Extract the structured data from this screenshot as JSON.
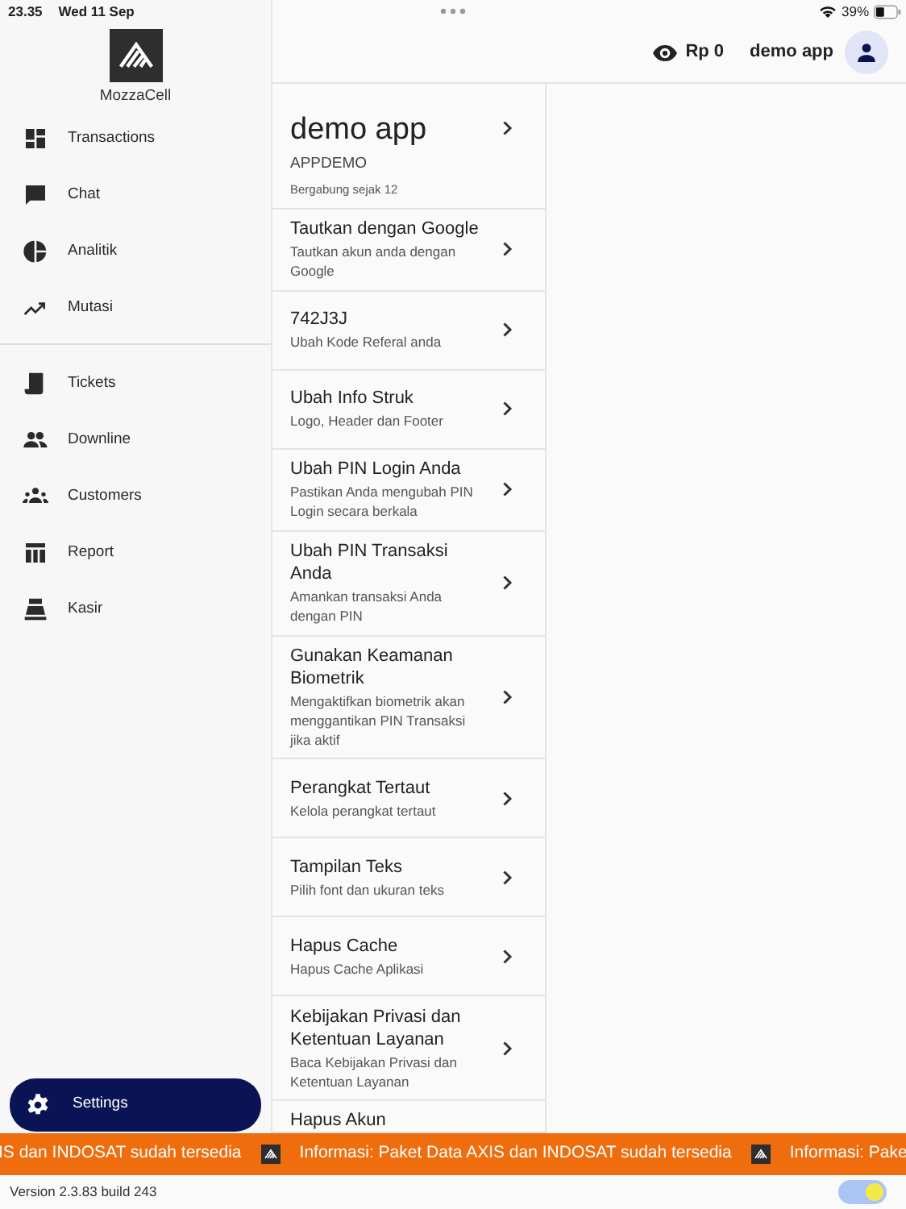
{
  "status_bar": {
    "time": "23.35",
    "date": "Wed 11 Sep",
    "battery": "39%"
  },
  "sidebar": {
    "brand": "MozzaCell",
    "groups": [
      [
        {
          "label": "Transactions",
          "selected": false
        },
        {
          "label": "Chat",
          "selected": false
        },
        {
          "label": "Analitik",
          "selected": false
        },
        {
          "label": "Mutasi",
          "selected": false
        }
      ],
      [
        {
          "label": "Tickets",
          "selected": false
        },
        {
          "label": "Downline",
          "selected": false
        },
        {
          "label": "Customers",
          "selected": false
        },
        {
          "label": "Report",
          "selected": false
        },
        {
          "label": "Kasir",
          "selected": false
        }
      ]
    ],
    "settings": {
      "label": "Settings",
      "selected": true
    }
  },
  "header": {
    "balance": "Rp 0",
    "user": "demo app"
  },
  "profile": {
    "name": "demo app",
    "code": "APPDEMO",
    "joined": "Bergabung sejak 12"
  },
  "settings_list": [
    {
      "title": "Tautkan dengan Google",
      "subtitle": "Tautkan akun anda dengan Google"
    },
    {
      "title": "742J3J",
      "subtitle": "Ubah Kode Referal anda"
    },
    {
      "title": "Ubah Info Struk",
      "subtitle": "Logo, Header dan Footer"
    },
    {
      "title": "Ubah PIN Login Anda",
      "subtitle": "Pastikan Anda mengubah PIN Login secara berkala"
    },
    {
      "title": "Ubah PIN Transaksi Anda",
      "subtitle": "Amankan transaksi Anda dengan PIN"
    },
    {
      "title": "Gunakan Keamanan Biometrik",
      "subtitle": "Mengaktifkan biometrik akan menggantikan PIN Transaksi jika aktif"
    },
    {
      "title": "Perangkat Tertaut",
      "subtitle": "Kelola perangkat tertaut"
    },
    {
      "title": "Tampilan Teks",
      "subtitle": "Pilih font dan ukuran teks"
    },
    {
      "title": "Hapus Cache",
      "subtitle": "Hapus Cache Aplikasi"
    },
    {
      "title": "Kebijakan Privasi dan Ketentuan Layanan",
      "subtitle": "Baca Kebijakan Privasi dan Ketentuan Layanan"
    },
    {
      "title": "Hapus Akun"
    }
  ],
  "ticker": [
    "IS dan INDOSAT sudah tersedia",
    "Informasi: Paket Data AXIS dan INDOSAT sudah tersedia",
    "Informasi: Pake"
  ],
  "footer": {
    "version": "Version 2.3.83 build 243",
    "theme_toggle": {
      "on": true
    }
  }
}
